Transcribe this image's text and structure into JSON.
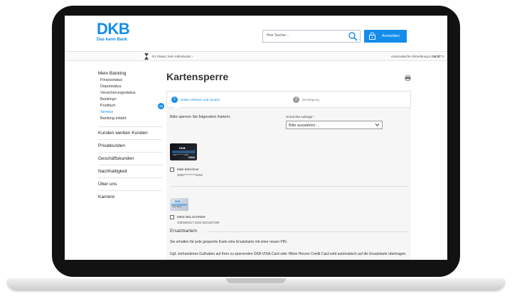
{
  "header": {
    "logo_text": "DKB",
    "logo_tagline": "Das kann Bank",
    "search_placeholder": "Ihre Suche...",
    "login_label": "Anmelden"
  },
  "statusbar": {
    "status_text": "Ihr Status: kein Aktivkunde ›",
    "logout_prefix": "Automatische Abmeldung in ",
    "logout_time": "04:37",
    "logout_suffix": " ↻"
  },
  "sidebar": {
    "top_label": "Mein Banking",
    "sub_items": [
      {
        "label": "Finanzstatus"
      },
      {
        "label": "Depotstatus"
      },
      {
        "label": "Versicherungsstatus"
      },
      {
        "label": "Banking+"
      },
      {
        "label": "Postfach",
        "badge": "15"
      },
      {
        "label": "Service"
      },
      {
        "label": "Banking erklärt"
      }
    ],
    "sections": [
      {
        "label": "Kunden werben Kunden"
      },
      {
        "label": "Privatkunden"
      },
      {
        "label": "Geschäftskunden"
      },
      {
        "label": "Nachhaltigkeit"
      },
      {
        "label": "Über uns"
      },
      {
        "label": "Karriere"
      }
    ]
  },
  "main": {
    "title": "Kartensperre",
    "steps": [
      {
        "number": "1",
        "label": "Daten erfassen und senden"
      },
      {
        "number": "2",
        "label": "Bestätigung"
      }
    ],
    "instruction": "Bitte sperren Sie folgende/n Karte/n:",
    "reason_label": "Grund des Auftrags *",
    "reason_value": "Bitte auswählen ...",
    "cards": [
      {
        "holder": "Mike Belschner",
        "number": "4930**********6156",
        "card_logo": "DKB",
        "card_visa": "VISA",
        "card_print": "4930 **** **** 6156"
      },
      {
        "holder": "MIKE BELSCHNER",
        "number": "1081950117 2022 5221327199",
        "card_logo": "DKB",
        "card_print": "DEBITKARTE"
      }
    ],
    "ersatz_title": "Ersatzkarte/n",
    "ersatz_text1": "Sie erhalten für jede gesperrte Karte eine Ersatzkarte mit einer neuen PIN.",
    "ersatz_text2": "Ggf. vorhandenes Guthaben auf Ihrer zu sperrenden DKB-VISA-Card oder Hilton Honors Credit Card wird automatisch auf die Ersatzkarte übertragen."
  },
  "colors": {
    "brand_blue": "#148dea",
    "step_inactive": "#9a9a9a"
  }
}
